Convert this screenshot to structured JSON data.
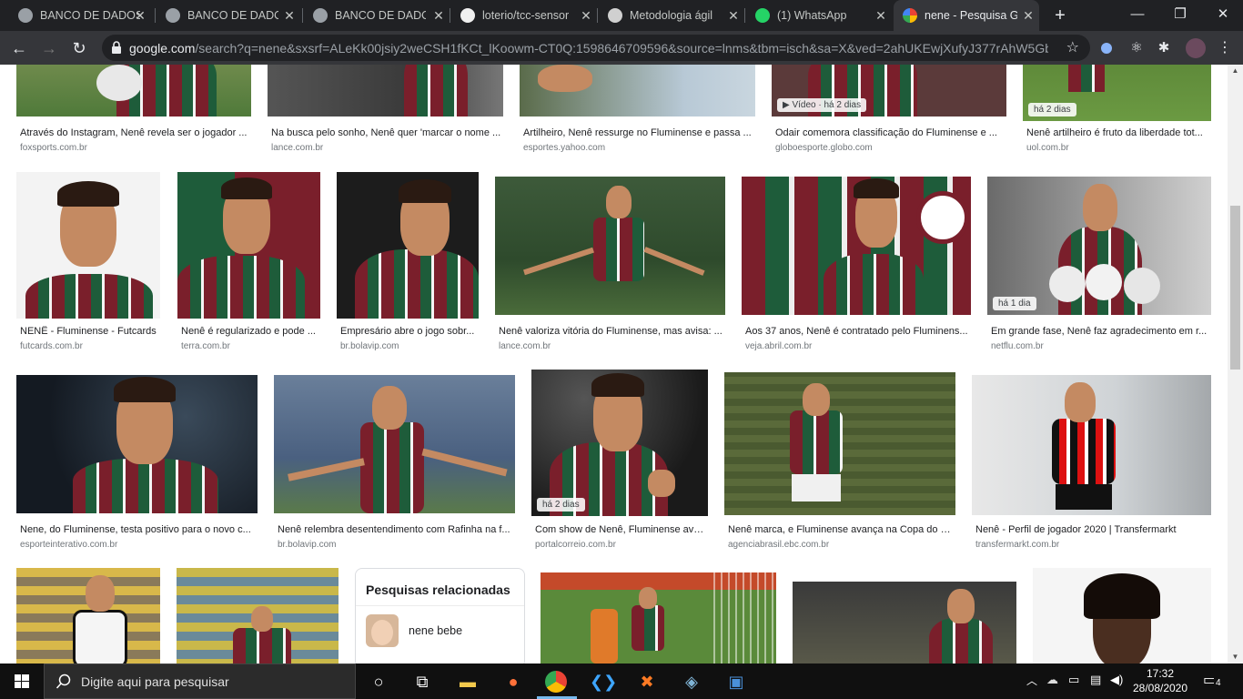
{
  "browser": {
    "tabs": [
      {
        "title": "BANCO DE DADOS",
        "favicon": "globe-icon",
        "active": false
      },
      {
        "title": "BANCO DE DADOS",
        "favicon": "globe-icon",
        "active": false
      },
      {
        "title": "BANCO DE DADOS",
        "favicon": "globe-icon",
        "active": false
      },
      {
        "title": "loterio/tcc-sensor",
        "favicon": "github-icon",
        "active": false
      },
      {
        "title": "Metodologia ágil",
        "favicon": "wordpress-icon",
        "active": false
      },
      {
        "title": "(1) WhatsApp",
        "favicon": "whatsapp-icon",
        "active": false
      },
      {
        "title": "nene - Pesquisa G",
        "favicon": "google-icon",
        "active": true
      }
    ],
    "url_host": "google.com",
    "url_rest": "/search?q=nene&sxsrf=ALeKk00jsiy2weCSH1fKCt_lKoowm-CT0Q:1598646709596&source=lnms&tbm=isch&sa=X&ved=2ahUKEwjXufyJ377rAhW5Gb..."
  },
  "results_row1": [
    {
      "caption": "Através do Instagram, Nenê revela ser o jogador ...",
      "source": "foxsports.com.br",
      "badge": ""
    },
    {
      "caption": "Na busca pelo sonho, Nenê quer 'marcar o nome ...",
      "source": "lance.com.br",
      "badge": ""
    },
    {
      "caption": "Artilheiro, Nenê ressurge no Fluminense e passa ...",
      "source": "esportes.yahoo.com",
      "badge": ""
    },
    {
      "caption": "Odair comemora classificação do Fluminense e ...",
      "source": "globoesporte.globo.com",
      "badge": "▶ Vídeo · há 2 dias"
    },
    {
      "caption": "Nenê artilheiro é fruto da liberdade tot...",
      "source": "uol.com.br",
      "badge": "há 2 dias"
    }
  ],
  "results_row2": [
    {
      "caption": "NENÊ - Fluminense - Futcards",
      "source": "futcards.com.br",
      "badge": ""
    },
    {
      "caption": "Nenê é regularizado e pode ...",
      "source": "terra.com.br",
      "badge": ""
    },
    {
      "caption": "Empresário abre o jogo sobr...",
      "source": "br.bolavip.com",
      "badge": ""
    },
    {
      "caption": "Nenê valoriza vitória do Fluminense, mas avisa: ...",
      "source": "lance.com.br",
      "badge": ""
    },
    {
      "caption": "Aos 37 anos, Nenê é contratado pelo Fluminens...",
      "source": "veja.abril.com.br",
      "badge": ""
    },
    {
      "caption": "Em grande fase, Nenê faz agradecimento em r...",
      "source": "netflu.com.br",
      "badge": "há 1 dia"
    }
  ],
  "results_row3": [
    {
      "caption": "Nene, do Fluminense, testa positivo para o novo c...",
      "source": "esporteinterativo.com.br",
      "badge": ""
    },
    {
      "caption": "Nenê relembra desentendimento com Rafinha na f...",
      "source": "br.bolavip.com",
      "badge": ""
    },
    {
      "caption": "Com show de Nenê, Fluminense ava...",
      "source": "portalcorreio.com.br",
      "badge": "há 2 dias"
    },
    {
      "caption": "Nenê marca, e Fluminense avança na Copa do B...",
      "source": "agenciabrasil.ebc.com.br",
      "badge": ""
    },
    {
      "caption": "Nenê - Perfil de jogador 2020 | Transfermarkt",
      "source": "transfermarkt.com.br",
      "badge": ""
    }
  ],
  "related": {
    "title": "Pesquisas relacionadas",
    "item_label": "nene bebe"
  },
  "taskbar": {
    "search_placeholder": "Digite aqui para pesquisar",
    "time": "17:32",
    "date": "28/08/2020",
    "notifications": "4"
  },
  "colors": {
    "flu_grena": "#7a1f2b",
    "flu_verde": "#1e5c3a",
    "chrome_dark": "#202124",
    "chrome_toolbar": "#35363a"
  }
}
